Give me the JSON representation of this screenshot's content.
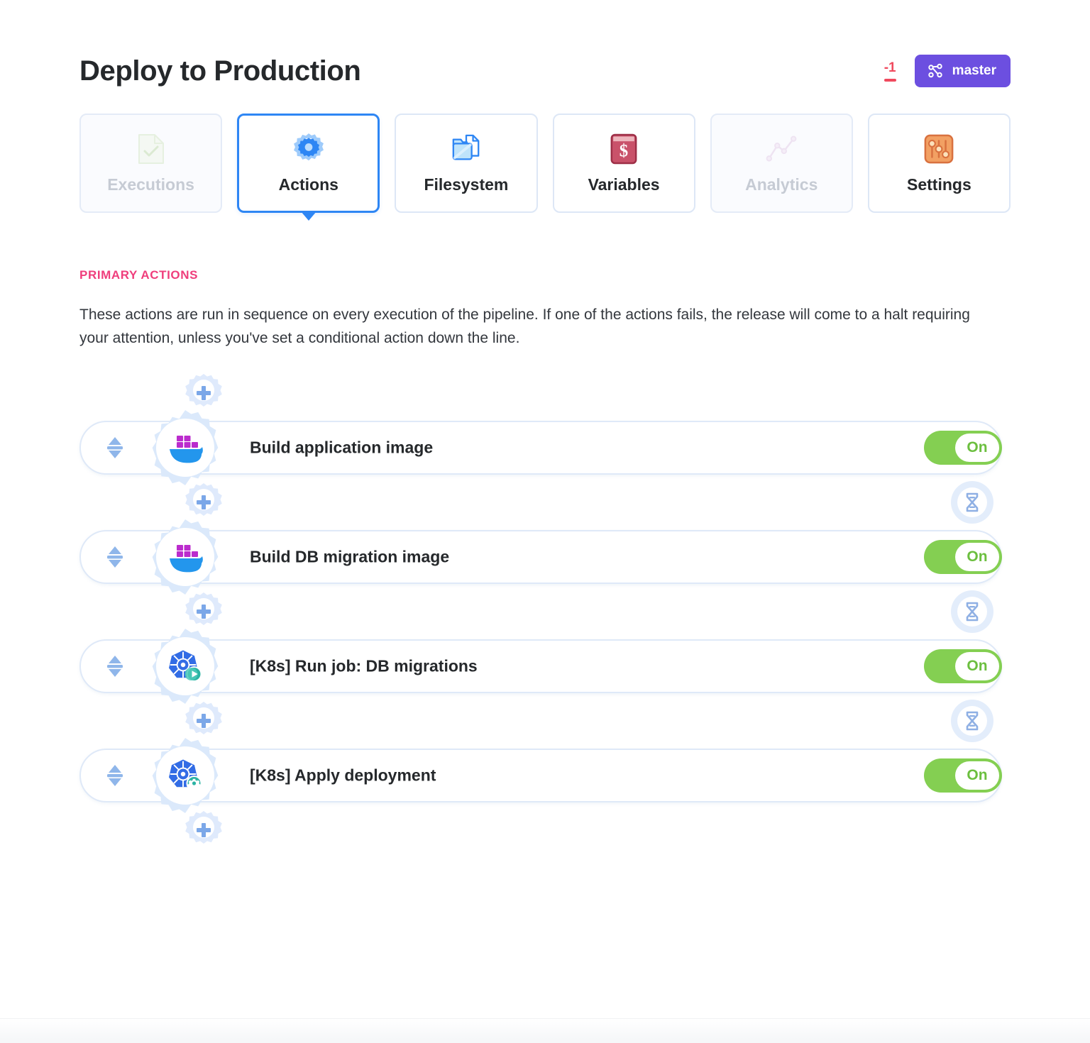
{
  "header": {
    "title": "Deploy to Production",
    "delta": "-1",
    "branch": "master",
    "branch_icon": "git-branch-icon"
  },
  "tabs": [
    {
      "label": "Executions",
      "icon": "document-check-icon",
      "state": "disabled"
    },
    {
      "label": "Actions",
      "icon": "gear-icon",
      "state": "active"
    },
    {
      "label": "Filesystem",
      "icon": "folder-file-icon",
      "state": "default"
    },
    {
      "label": "Variables",
      "icon": "dollar-book-icon",
      "state": "default"
    },
    {
      "label": "Analytics",
      "icon": "line-chart-icon",
      "state": "disabled"
    },
    {
      "label": "Settings",
      "icon": "sliders-icon",
      "state": "default"
    }
  ],
  "section": {
    "title": "PRIMARY ACTIONS",
    "description": "These actions are run in sequence on every execution of the pipeline. If one of the actions fails, the release will come to a halt requiring your attention, unless you've set a conditional action down the line."
  },
  "actions": [
    {
      "label": "Build application image",
      "icon": "docker-icon",
      "toggle": "On"
    },
    {
      "label": "Build DB migration image",
      "icon": "docker-icon",
      "toggle": "On"
    },
    {
      "label": "[K8s] Run job: DB migrations",
      "icon": "kubernetes-run-icon",
      "toggle": "On"
    },
    {
      "label": "[K8s] Apply deployment",
      "icon": "kubernetes-config-icon",
      "toggle": "On"
    }
  ],
  "connectors": {
    "add_icon": "add-action-gear-icon",
    "wait_icon": "hourglass-icon"
  },
  "colors": {
    "accent_blue": "#2e86f4",
    "branch_purple": "#6c4fe0",
    "section_pink": "#ef3e7c",
    "toggle_green": "#84cf52",
    "delta_red": "#f04a5e",
    "docker_blue": "#2396ed",
    "docker_purple": "#bb2ccd",
    "kubernetes_blue": "#326ce5"
  }
}
